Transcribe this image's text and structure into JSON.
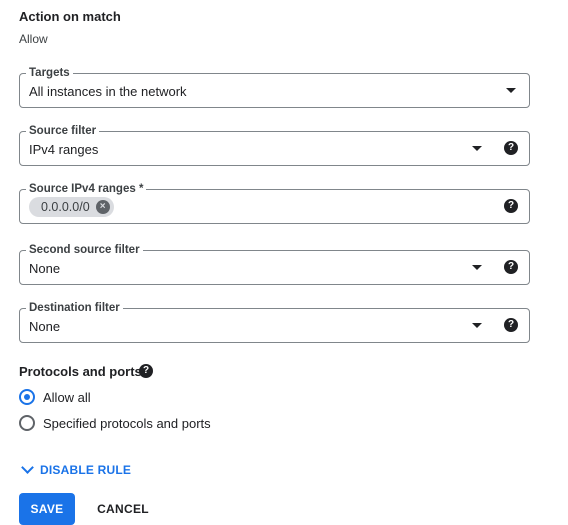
{
  "action": {
    "title": "Action on match",
    "value": "Allow"
  },
  "fields": {
    "targets": {
      "label": "Targets",
      "value": "All instances in the network"
    },
    "source_filter": {
      "label": "Source filter",
      "value": "IPv4 ranges",
      "help": "?"
    },
    "source_ranges": {
      "label": "Source IPv4 ranges *",
      "chip": "0.0.0.0/0",
      "chip_remove": "×",
      "help": "?"
    },
    "second_source": {
      "label": "Second source filter",
      "value": "None",
      "help": "?"
    },
    "destination": {
      "label": "Destination filter",
      "value": "None",
      "help": "?"
    }
  },
  "protocols": {
    "title": "Protocols and ports",
    "help": "?",
    "options": [
      {
        "label": "Allow all",
        "selected": true
      },
      {
        "label": "Specified protocols and ports",
        "selected": false
      }
    ]
  },
  "disable_rule": "DISABLE RULE",
  "buttons": {
    "save": "SAVE",
    "cancel": "CANCEL"
  },
  "colors": {
    "accent": "#1a73e8",
    "border": "#80868b",
    "chip": "#dadce0"
  },
  "icons": [
    "dropdown-caret-icon",
    "help-icon",
    "remove-chip-icon",
    "chevron-down-icon",
    "radio-icon"
  ]
}
